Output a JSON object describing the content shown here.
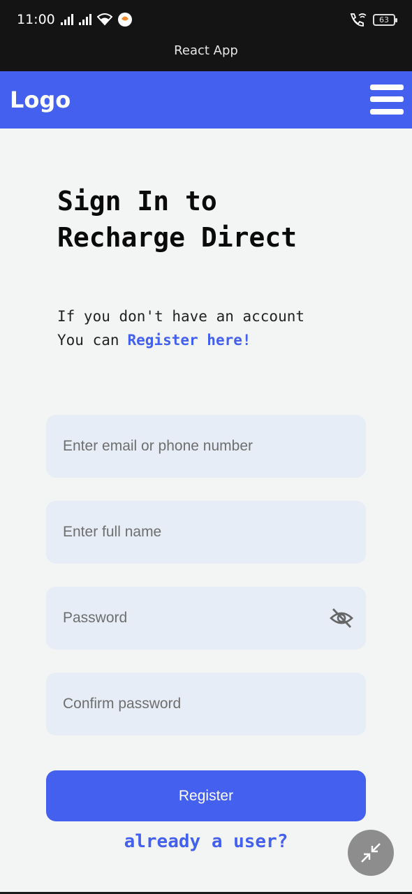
{
  "status_bar": {
    "time": "11:00",
    "battery": "63"
  },
  "app_title": "React App",
  "navbar": {
    "logo": "Logo",
    "menu_icon": "hamburger-menu-icon"
  },
  "heading": {
    "line1": "Sign In to",
    "line2": "Recharge Direct"
  },
  "intro": {
    "line1": "If you don't have an account",
    "line2_prefix": "You can",
    "register_link": "Register here!"
  },
  "form": {
    "email": {
      "value": "",
      "placeholder": "Enter email or phone number"
    },
    "full_name": {
      "value": "",
      "placeholder": "Enter full name"
    },
    "password": {
      "value": "",
      "placeholder": "Password",
      "toggle_icon": "eye-off-icon"
    },
    "confirm_password": {
      "value": "",
      "placeholder": "Confirm password"
    },
    "register_button": "Register"
  },
  "already_user_link": "already a user?",
  "fab_icon": "minimize-arrows-icon",
  "colors": {
    "accent": "#4360ef",
    "background": "#f3f4f4",
    "field_bg": "#e7edf6",
    "status_bar": "#141414"
  }
}
